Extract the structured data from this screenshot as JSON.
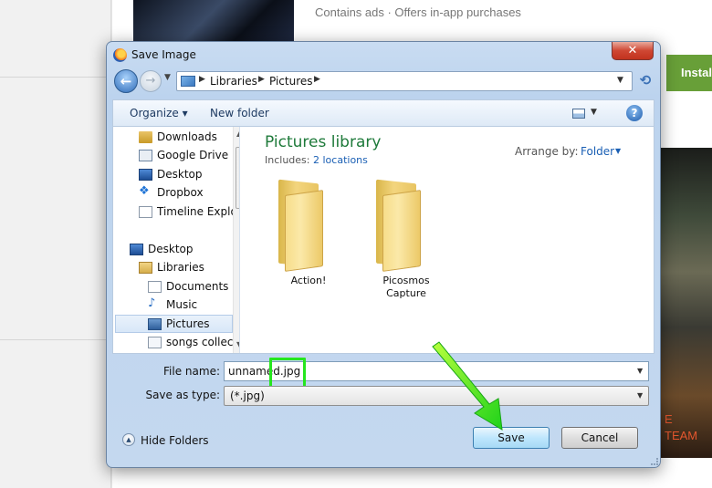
{
  "background": {
    "ad_text": "Contains ads · Offers in-app purchases",
    "install_label": "Install",
    "banner_line1": "E",
    "banner_line2": "TEAM"
  },
  "dialog": {
    "title": "Save Image",
    "close_glyph": "✕",
    "address": {
      "crumbs": [
        "Libraries",
        "Pictures"
      ]
    },
    "toolbar": {
      "organize": "Organize ▾",
      "new_folder": "New folder",
      "help_glyph": "?"
    },
    "nav_tree": [
      {
        "label": "Downloads",
        "icon": "downloads-folder-icon"
      },
      {
        "label": "Google Drive",
        "icon": "google-drive-icon"
      },
      {
        "label": "Desktop",
        "icon": "desktop-icon"
      },
      {
        "label": "Dropbox",
        "icon": "dropbox-icon"
      },
      {
        "label": "Timeline Explor",
        "icon": "document-icon"
      },
      {
        "label": "Desktop",
        "icon": "desktop-icon"
      },
      {
        "label": "Libraries",
        "icon": "libraries-icon"
      },
      {
        "label": "Documents",
        "icon": "documents-icon"
      },
      {
        "label": "Music",
        "icon": "music-icon"
      },
      {
        "label": "Pictures",
        "icon": "pictures-icon",
        "selected": true
      },
      {
        "label": "songs collecti",
        "icon": "songs-icon"
      }
    ],
    "library": {
      "title": "Pictures library",
      "includes_label": "Includes:",
      "includes_link": "2 locations",
      "arrange_label": "Arrange by:",
      "arrange_value": "Folder"
    },
    "folders": [
      {
        "label": "Action!"
      },
      {
        "label": "Picosmos\nCapture"
      }
    ],
    "file_name_label": "File name:",
    "file_name_value": "unnamed.jpg",
    "save_as_type_label": "Save as type:",
    "save_as_type_value": "(*.jpg)",
    "hide_folders": "Hide Folders",
    "save_button": "Save",
    "cancel_button": "Cancel"
  },
  "colors": {
    "highlight": "#26e61e",
    "install_green": "#689f38",
    "library_title": "#1e7a3a",
    "link_blue": "#1a5fb4"
  }
}
